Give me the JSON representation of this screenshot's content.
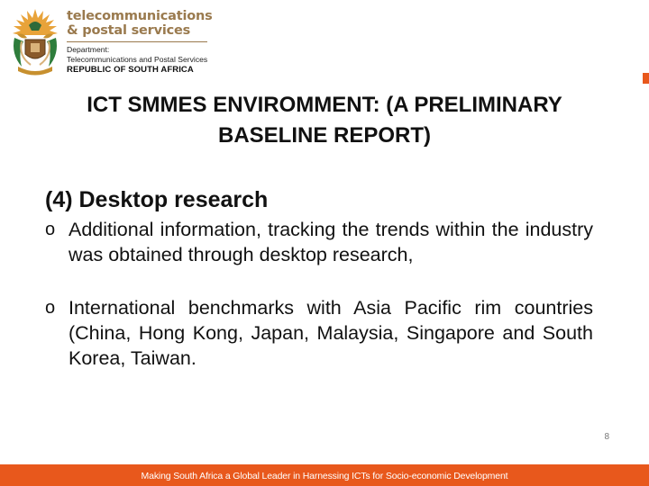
{
  "header": {
    "brand_line1": "telecommunications",
    "brand_line2": "& postal services",
    "department_label": "Department:",
    "department_name": "Telecommunications and Postal Services",
    "country": "REPUBLIC OF SOUTH AFRICA",
    "accent_color": "#e8581c",
    "brand_color": "#9a7a4e"
  },
  "slide": {
    "title_line1": "ICT SMMES ENVIROMMENT: (A PRELIMINARY",
    "title_line2": "BASELINE REPORT)",
    "section_heading": "(4) Desktop research",
    "bullets": [
      {
        "marker": "o",
        "text": "Additional information, tracking the trends within the industry was obtained through desktop research,"
      },
      {
        "marker": "o",
        "text": "International benchmarks with Asia Pacific rim countries (China, Hong Kong, Japan, Malaysia, Singapore and South Korea, Taiwan."
      }
    ],
    "page_number": "8"
  },
  "footer": {
    "text": "Making South Africa a Global Leader in Harnessing ICTs for Socio-economic Development"
  }
}
